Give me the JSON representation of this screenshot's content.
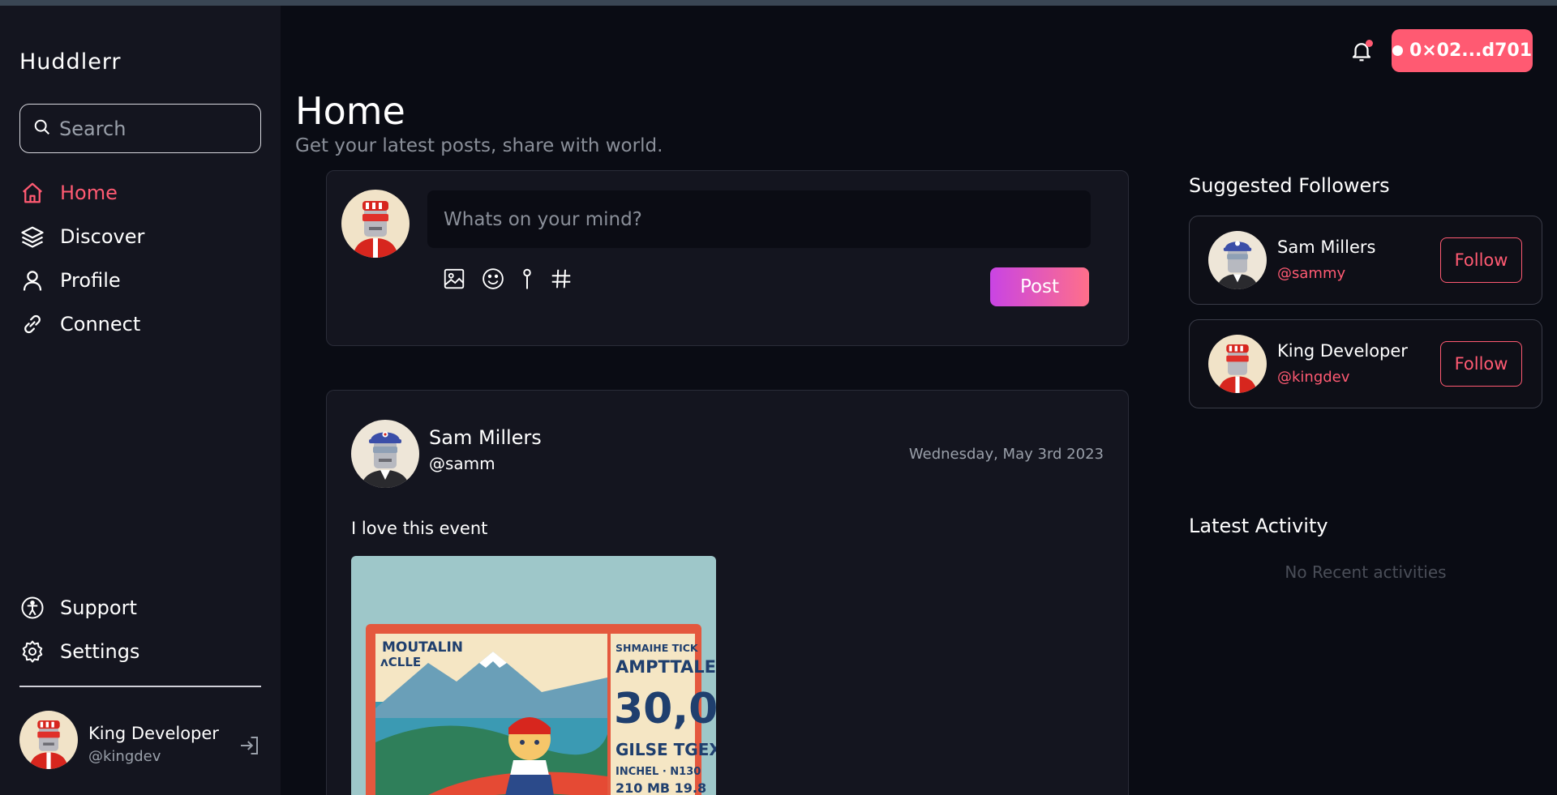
{
  "app": {
    "name": "Huddlerr"
  },
  "search": {
    "placeholder": "Search"
  },
  "nav": {
    "items": [
      {
        "label": "Home",
        "icon": "home-icon",
        "active": true
      },
      {
        "label": "Discover",
        "icon": "layers-icon"
      },
      {
        "label": "Profile",
        "icon": "user-icon"
      },
      {
        "label": "Connect",
        "icon": "link-icon"
      }
    ],
    "bottom": [
      {
        "label": "Support",
        "icon": "accessibility-icon"
      },
      {
        "label": "Settings",
        "icon": "gear-icon"
      }
    ]
  },
  "current_user": {
    "name": "King Developer",
    "handle": "@kingdev"
  },
  "header": {
    "wallet": "0×02...d701",
    "title": "Home",
    "subtitle": "Get your latest posts, share with world."
  },
  "composer": {
    "placeholder": "Whats on your mind?",
    "post_label": "Post",
    "tools": [
      "image-icon",
      "emoji-icon",
      "location-pin-icon",
      "hashtag-icon"
    ]
  },
  "post": {
    "author": "Sam Millers",
    "handle": "@samm",
    "date": "Wednesday, May 3rd 2023",
    "text": "I love this event",
    "image_text": {
      "left": [
        "MOUTALIN",
        "ʌCLLE"
      ],
      "right": [
        "SHMAIHE TICK",
        "AMPTTALE",
        "30,0",
        "GILSE TGEX",
        "INCHEL · N130",
        "210 MB 19.8"
      ]
    }
  },
  "suggested": {
    "title": "Suggested Followers",
    "items": [
      {
        "name": "Sam Millers",
        "handle": "@sammy",
        "button": "Follow"
      },
      {
        "name": "King Developer",
        "handle": "@kingdev",
        "button": "Follow"
      }
    ]
  },
  "activity": {
    "title": "Latest Activity",
    "empty": "No Recent activities"
  },
  "colors": {
    "accent": "#ff5a72",
    "bg": "#0a0c14",
    "panel": "#14151f",
    "gradient_start": "#c944e4",
    "gradient_end": "#ff6f8a"
  }
}
